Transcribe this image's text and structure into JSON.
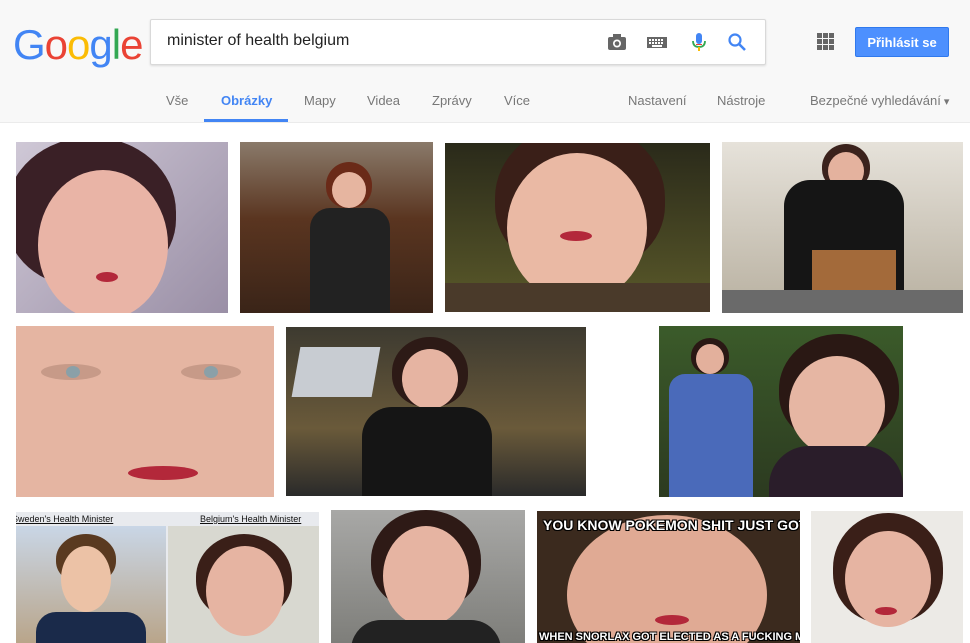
{
  "logo": {
    "letters": [
      "G",
      "o",
      "o",
      "g",
      "l",
      "e"
    ]
  },
  "search": {
    "query": "minister of health belgium"
  },
  "header": {
    "signin_label": "Přihlásit se"
  },
  "tabs": [
    {
      "label": "Vše"
    },
    {
      "label": "Obrázky"
    },
    {
      "label": "Mapy"
    },
    {
      "label": "Videa"
    },
    {
      "label": "Zprávy"
    },
    {
      "label": "Více"
    }
  ],
  "tools": {
    "settings": "Nastavení",
    "tools": "Nástroje",
    "safe_search": "Bezpečné vyhledávání"
  },
  "images": {
    "sweden_caption": "Sweden's Health Minister",
    "belgium_caption": "Belgium's Health Minister",
    "meme_top": "YOU KNOW POKEMON SHIT JUST GOT REAL",
    "meme_bottom": "WHEN SNORLAX GOT ELECTED AS A FUCKING MINISTER"
  },
  "colors": {
    "accent": "#4285f4",
    "button": "#4d90fe"
  }
}
